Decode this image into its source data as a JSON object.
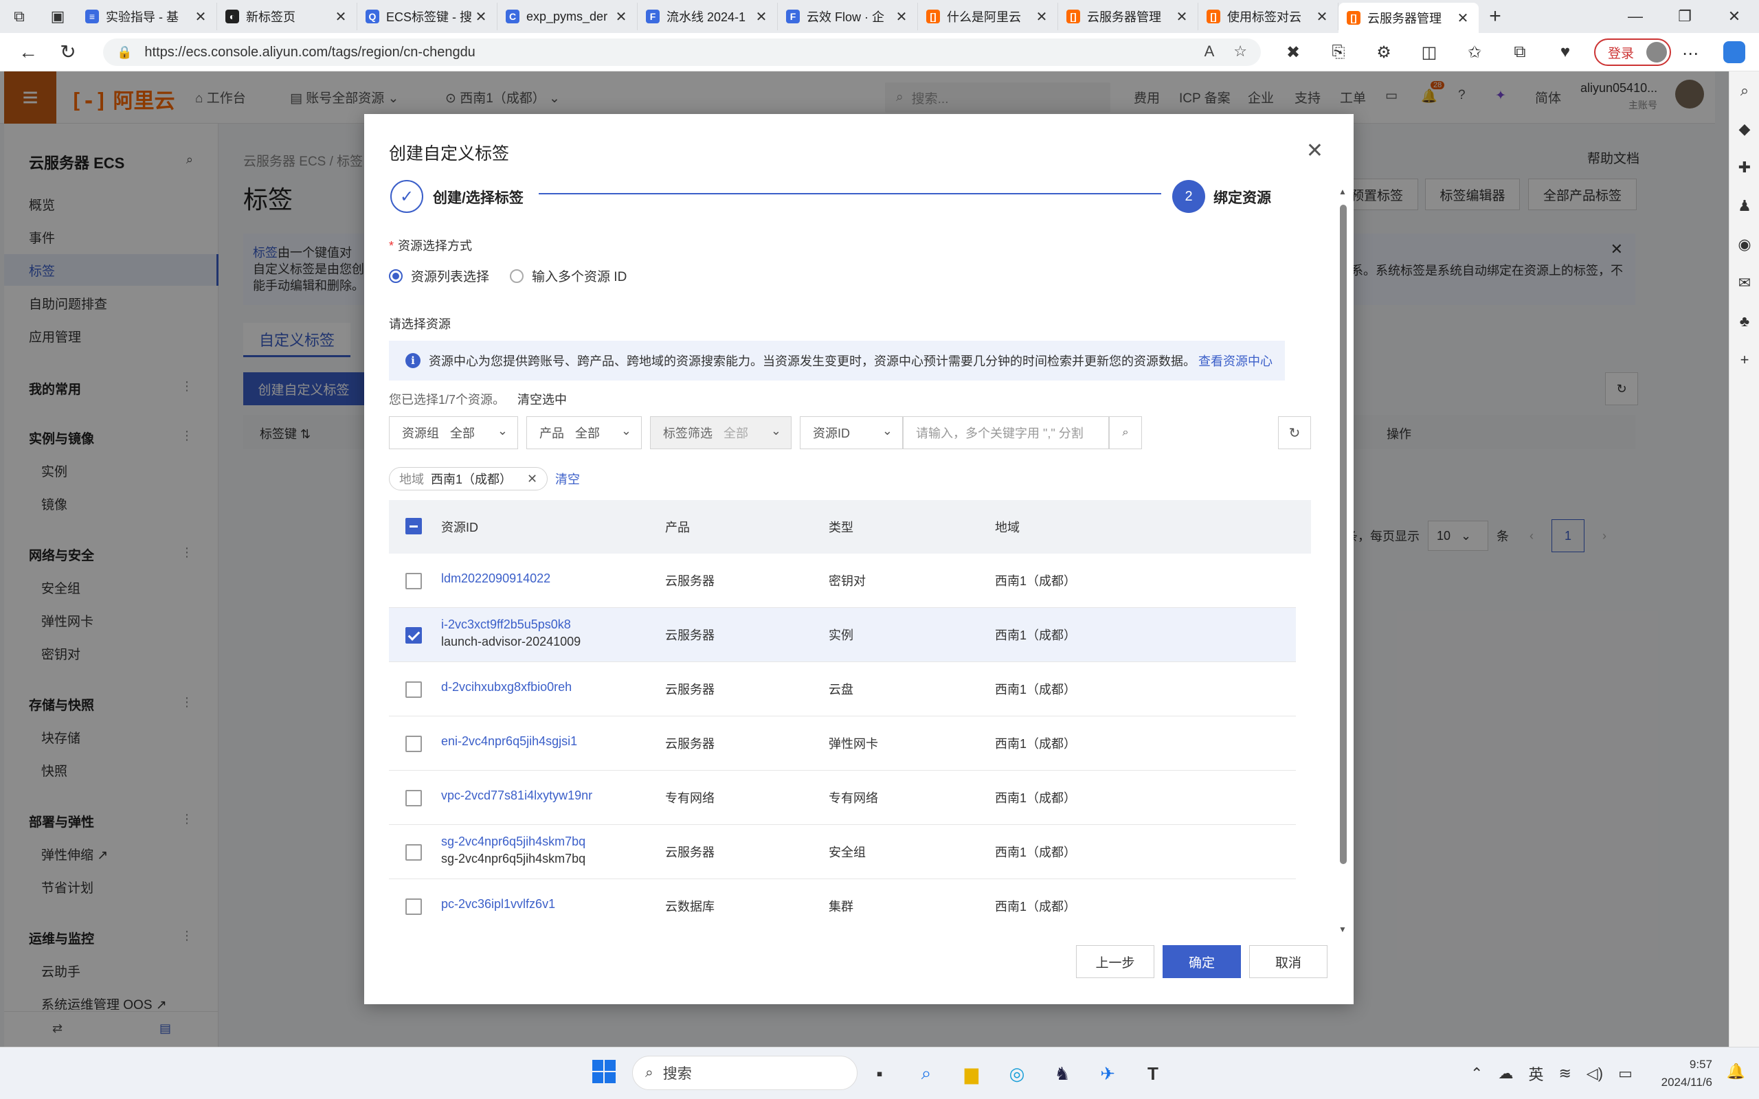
{
  "browser": {
    "tabs": [
      {
        "label": "实验指导 - 基",
        "color": "#3b6be0",
        "glyph": "≡"
      },
      {
        "label": "新标签页",
        "color": "#222222",
        "glyph": "◐"
      },
      {
        "label": "ECS标签键 - 搜",
        "color": "#3b6be0",
        "glyph": "Q"
      },
      {
        "label": "exp_pyms_der",
        "color": "#3b6be0",
        "glyph": "C"
      },
      {
        "label": "流水线 2024-1",
        "color": "#3b6be0",
        "glyph": "F"
      },
      {
        "label": "云效 Flow · 企",
        "color": "#3b6be0",
        "glyph": "F"
      },
      {
        "label": "什么是阿里云",
        "color": "#ff6a00",
        "glyph": "[]"
      },
      {
        "label": "云服务器管理",
        "color": "#ff6a00",
        "glyph": "[]"
      },
      {
        "label": "使用标签对云",
        "color": "#ff6a00",
        "glyph": "[]"
      },
      {
        "label": "云服务器管理",
        "color": "#ff6a00",
        "glyph": "[]",
        "active": true
      }
    ],
    "url": "https://ecs.console.aliyun.com/tags/region/cn-chengdu",
    "login": "登录"
  },
  "header": {
    "logo": "阿里云",
    "workbench": "工作台",
    "account_scope": "账号全部资源",
    "region": "西南1（成都）",
    "search_placeholder": "搜索...",
    "items": [
      "费用",
      "ICP 备案",
      "企业",
      "支持",
      "工单"
    ],
    "notification_count": "28",
    "lang": "简体",
    "user": "aliyun05410...",
    "user_sub": "主账号"
  },
  "sidebar": {
    "title": "云服务器 ECS",
    "items": [
      "概览",
      "事件",
      "标签",
      "自助问题排查",
      "应用管理"
    ],
    "groups": [
      {
        "label": "我的常用",
        "items": []
      },
      {
        "label": "实例与镜像",
        "items": [
          "实例",
          "镜像"
        ]
      },
      {
        "label": "网络与安全",
        "items": [
          "安全组",
          "弹性网卡",
          "密钥对"
        ]
      },
      {
        "label": "存储与快照",
        "items": [
          "块存储",
          "快照"
        ]
      },
      {
        "label": "部署与弹性",
        "items": [
          "弹性伸缩",
          "节省计划"
        ]
      },
      {
        "label": "运维与监控",
        "items": [
          "云助手",
          "系统运维管理 OOS"
        ]
      }
    ]
  },
  "main": {
    "crumb": "云服务器 ECS / 标签",
    "title": "标签",
    "help": "帮助文档",
    "buttons": [
      "预置标签",
      "标签编辑器",
      "全部产品标签"
    ],
    "info_prefix": "标签",
    "info_line1": "由一个键值对",
    "info_line2": "自定义标签是由您创",
    "info_line3": "能手动编辑和删除。",
    "info_right": "系。系统标签是系统自动绑定在资源上的标签，不",
    "tab": "自定义标签",
    "create_btn": "创建自定义标签",
    "col_key": "标签键",
    "col_op": "操作",
    "pager_text": "条，每页显示",
    "page_size": "10",
    "page_unit": "条",
    "page": "1"
  },
  "modal": {
    "title": "创建自定义标签",
    "step1": "创建/选择标签",
    "step2_num": "2",
    "step2": "绑定资源",
    "method_label": "资源选择方式",
    "method_options": [
      "资源列表选择",
      "输入多个资源 ID"
    ],
    "choose_label": "请选择资源",
    "notice": "资源中心为您提供跨账号、跨产品、跨地域的资源搜索能力。当资源发生变更时，资源中心预计需要几分钟的时间检索并更新您的资源数据。",
    "notice_link": "查看资源中心",
    "selected_info": "您已选择1/7个资源。",
    "clear_selected": "清空选中",
    "filters": {
      "group_label": "资源组",
      "group_value": "全部",
      "product_label": "产品",
      "product_value": "全部",
      "tag_label": "标签筛选",
      "tag_value": "全部",
      "field": "资源ID",
      "keyword_placeholder": "请输入，多个关键字用 \",\" 分割"
    },
    "chip_key": "地域",
    "chip_value": "西南1（成都）",
    "clear": "清空",
    "columns": [
      "资源ID",
      "产品",
      "类型",
      "地域"
    ],
    "rows": [
      {
        "id": "ldm2022090914022",
        "sub": "",
        "product": "云服务器",
        "type": "密钥对",
        "region": "西南1（成都）",
        "checked": false
      },
      {
        "id": "i-2vc3xct9ff2b5u5ps0k8",
        "sub": "launch-advisor-20241009",
        "product": "云服务器",
        "type": "实例",
        "region": "西南1（成都）",
        "checked": true
      },
      {
        "id": "d-2vcihxubxg8xfbio0reh",
        "sub": "",
        "product": "云服务器",
        "type": "云盘",
        "region": "西南1（成都）",
        "checked": false
      },
      {
        "id": "eni-2vc4npr6q5jih4sgjsi1",
        "sub": "",
        "product": "云服务器",
        "type": "弹性网卡",
        "region": "西南1（成都）",
        "checked": false
      },
      {
        "id": "vpc-2vcd77s81i4lxytyw19nr",
        "sub": "",
        "product": "专有网络",
        "type": "专有网络",
        "region": "西南1（成都）",
        "checked": false
      },
      {
        "id": "sg-2vc4npr6q5jih4skm7bq",
        "sub": "sg-2vc4npr6q5jih4skm7bq",
        "product": "云服务器",
        "type": "安全组",
        "region": "西南1（成都）",
        "checked": false
      },
      {
        "id": "pc-2vc36ipl1vvlfz6v1",
        "sub": "",
        "product": "云数据库",
        "type": "集群",
        "region": "西南1（成都）",
        "checked": false
      }
    ],
    "btn_prev": "上一步",
    "btn_ok": "确定",
    "btn_cancel": "取消"
  },
  "taskbar": {
    "search": "搜索",
    "ime": "英",
    "time": "9:57",
    "date": "2024/11/6"
  },
  "colors": {
    "primary": "#3b5fc9",
    "brand": "#ff6a00"
  }
}
